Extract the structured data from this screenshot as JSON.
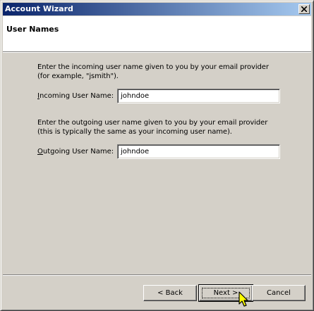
{
  "window": {
    "title": "Account Wizard"
  },
  "header": {
    "title": "User Names"
  },
  "incoming": {
    "description": "Enter the incoming user name given to you by your email provider (for example, \"jsmith\").",
    "label_mnemonic": "I",
    "label_rest": "ncoming User Name:",
    "value": "johndoe"
  },
  "outgoing": {
    "description": "Enter the outgoing user name given to you by your email provider (this is typically the same as your incoming user name).",
    "label_mnemonic": "O",
    "label_rest": "utgoing User Name:",
    "value": "johndoe"
  },
  "buttons": {
    "back": "< Back",
    "next": "Next >",
    "cancel": "Cancel"
  },
  "colors": {
    "titlebar_start": "#0a246a",
    "titlebar_end": "#a6caf0",
    "face": "#d4d0c8"
  },
  "icons": {
    "close": "close-icon",
    "cursor": "mouse-pointer-icon"
  }
}
